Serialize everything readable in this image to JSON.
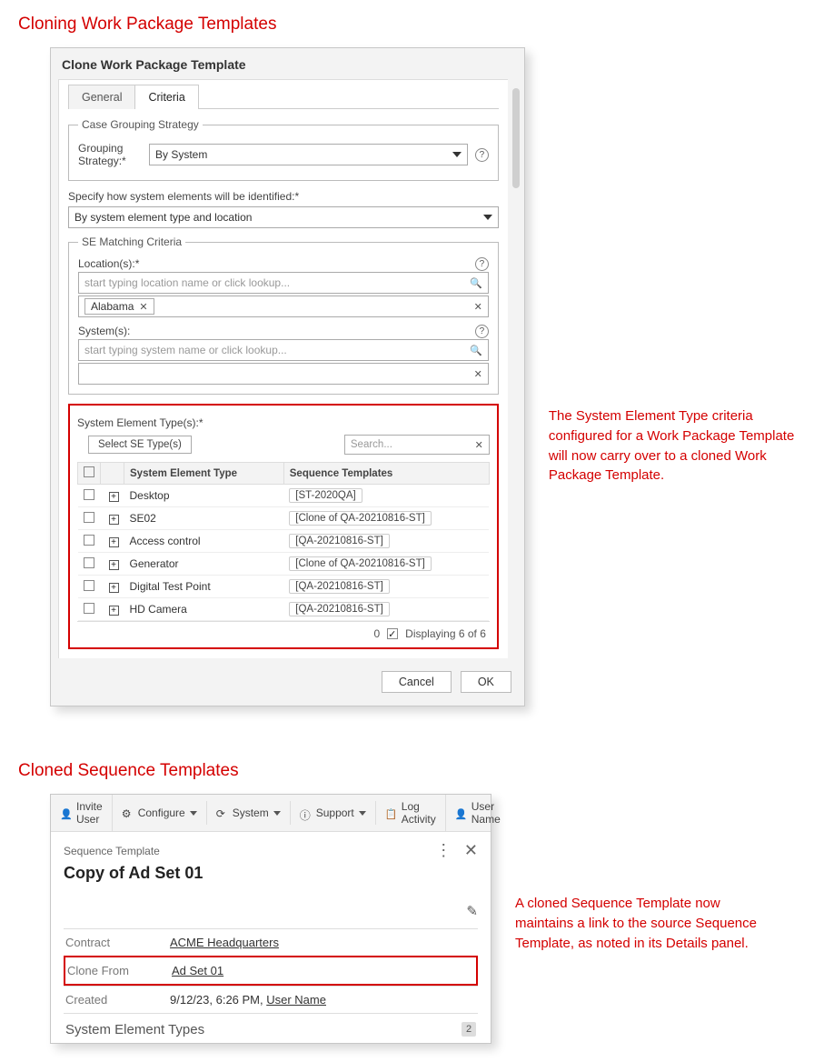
{
  "section1": {
    "heading": "Cloning Work Package Templates",
    "callout": "The System Element Type criteria configured for a Work Package Template will now carry over to a cloned Work Package Template."
  },
  "dialog": {
    "title": "Clone Work Package Template",
    "tabs": {
      "general": "General",
      "criteria": "Criteria"
    },
    "grouping": {
      "legend": "Case Grouping Strategy",
      "label": "Grouping Strategy:*",
      "value": "By System"
    },
    "identify": {
      "label": "Specify how system elements will be identified:*",
      "value": "By system element type and location"
    },
    "matching": {
      "legend": "SE Matching Criteria",
      "location_label": "Location(s):*",
      "location_placeholder": "start typing location name or click lookup...",
      "location_chip": "Alabama",
      "system_label": "System(s):",
      "system_placeholder": "start typing system name or click lookup..."
    },
    "setypes": {
      "label": "System Element Type(s):*",
      "select_btn": "Select SE Type(s)",
      "search_placeholder": "Search...",
      "col1": "System Element Type",
      "col2": "Sequence Templates",
      "rows": [
        {
          "name": "Desktop",
          "seq": "[ST-2020QA]"
        },
        {
          "name": "SE02",
          "seq": "[Clone of QA-20210816-ST]"
        },
        {
          "name": "Access control",
          "seq": "[QA-20210816-ST]"
        },
        {
          "name": "Generator",
          "seq": "[Clone of QA-20210816-ST]"
        },
        {
          "name": "Digital Test Point",
          "seq": "[QA-20210816-ST]"
        },
        {
          "name": "HD Camera",
          "seq": "[QA-20210816-ST]"
        }
      ],
      "footer_count": "0",
      "footer_text": "Displaying 6 of 6"
    },
    "buttons": {
      "cancel": "Cancel",
      "ok": "OK"
    }
  },
  "section2": {
    "heading": "Cloned Sequence Templates",
    "callout": "A cloned Sequence Template now maintains a link to the source Sequence Template, as noted in its Details panel."
  },
  "toolbar": {
    "invite": "Invite User",
    "configure": "Configure",
    "system": "System",
    "support": "Support",
    "log": "Log Activity",
    "user": "User Name"
  },
  "panel": {
    "subtype": "Sequence Template",
    "title": "Copy of Ad Set 01",
    "rows": {
      "contract_k": "Contract",
      "contract_v": "ACME Headquarters",
      "clone_k": "Clone From",
      "clone_v": "Ad Set 01",
      "created_k": "Created",
      "created_v_date": "9/12/23, 6:26 PM, ",
      "created_v_user": "User Name"
    },
    "section_sub": "System Element Types",
    "badge": "2"
  }
}
